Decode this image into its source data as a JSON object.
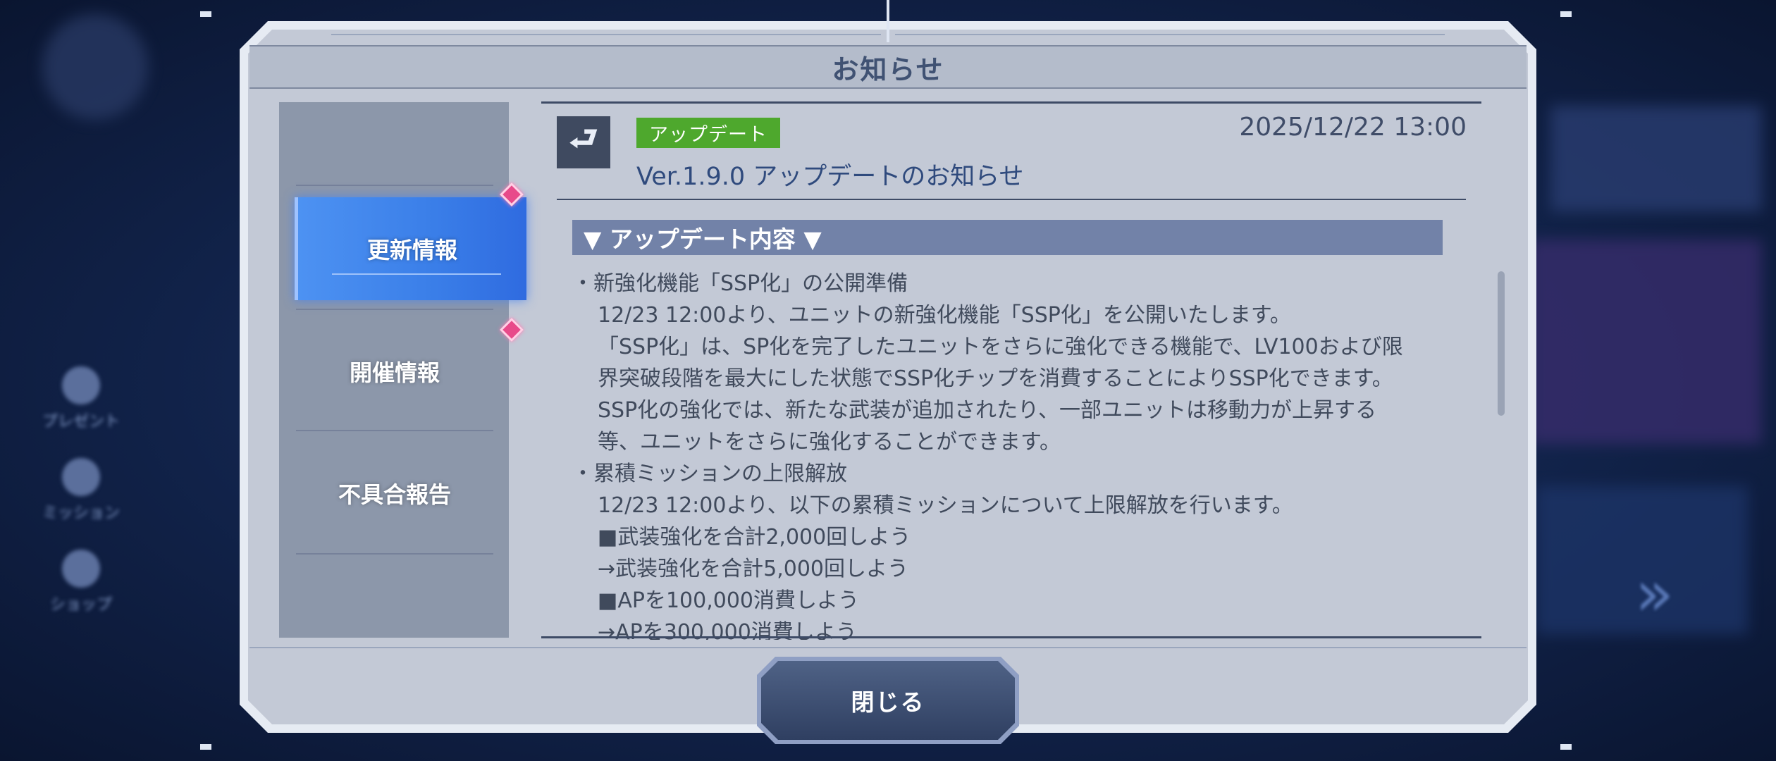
{
  "dialog": {
    "title": "お知らせ",
    "close_label": "閉じる"
  },
  "tabs": [
    {
      "label": "更新情報",
      "active": true,
      "has_new": true
    },
    {
      "label": "開催情報",
      "active": false,
      "has_new": true
    },
    {
      "label": "不具合報告",
      "active": false,
      "has_new": false
    }
  ],
  "article": {
    "icon": "return-arrow-icon",
    "category": "アップデート",
    "date": "2025/12/22 13:00",
    "headline": "Ver.1.9.0 アップデートのお知らせ",
    "section_heading": "▼ アップデート内容 ▼",
    "lines": [
      {
        "text": "・新強化機能「SSP化」の公開準備",
        "indent": false
      },
      {
        "text": "12/23 12:00より、ユニットの新強化機能「SSP化」を公開いたします。",
        "indent": true
      },
      {
        "text": "「SSP化」は、SP化を完了したユニットをさらに強化できる機能で、LV100および限",
        "indent": true
      },
      {
        "text": "界突破段階を最大にした状態でSSP化チップを消費することによりSSP化できます。",
        "indent": true
      },
      {
        "text": "SSP化の強化では、新たな武装が追加されたり、一部ユニットは移動力が上昇する",
        "indent": true
      },
      {
        "text": "等、ユニットをさらに強化することができます。",
        "indent": true
      },
      {
        "text": "・累積ミッションの上限解放",
        "indent": false
      },
      {
        "text": "12/23 12:00より、以下の累積ミッションについて上限解放を行います。",
        "indent": true
      },
      {
        "text": "■武装強化を合計2,000回しよう",
        "indent": true
      },
      {
        "text": "→武装強化を合計5,000回しよう",
        "indent": true
      },
      {
        "text": "■APを100,000消費しよう",
        "indent": true
      },
      {
        "text": "→APを300,000消費しよう",
        "indent": true
      }
    ]
  },
  "background": {
    "nav": [
      "プレゼント",
      "ミッション",
      "ショップ"
    ]
  },
  "colors": {
    "active_tab": "#3a7ee8",
    "badge_green": "#4ea82d",
    "new_marker": "#e84a8a",
    "section_bar": "#7282a8"
  }
}
